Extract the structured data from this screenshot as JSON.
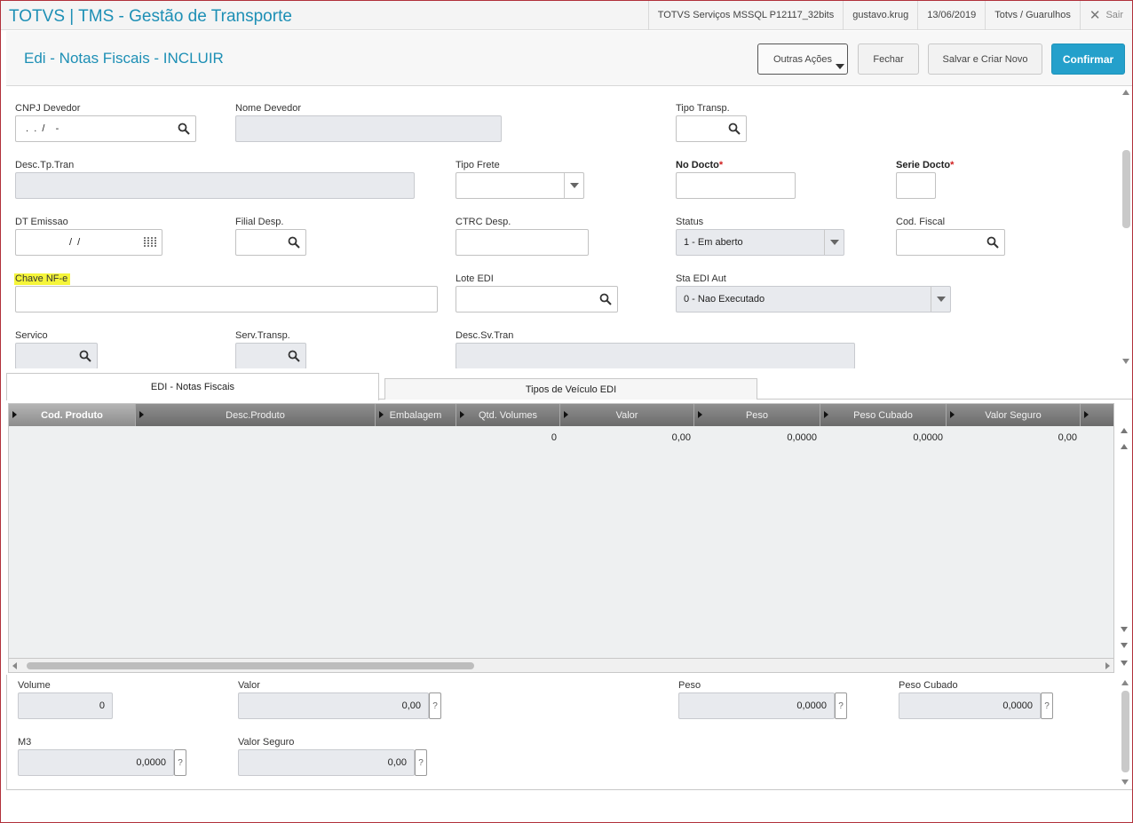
{
  "app": {
    "title": "TOTVS | TMS - Gestão de Transporte",
    "environment": "TOTVS Serviços MSSQL P12117_32bits",
    "user": "gustavo.krug",
    "date": "13/06/2019",
    "branch": "Totvs / Guarulhos",
    "exit_label": "Sair"
  },
  "header": {
    "page_title": "Edi - Notas Fiscais - INCLUIR",
    "btn_outras": "Outras Ações",
    "btn_fechar": "Fechar",
    "btn_salvar": "Salvar e Criar Novo",
    "btn_confirmar": "Confirmar"
  },
  "form": {
    "cnpj_devedor": {
      "label": "CNPJ Devedor",
      "value": " .  .  /    -"
    },
    "nome_devedor": {
      "label": "Nome Devedor",
      "value": ""
    },
    "tipo_transp": {
      "label": "Tipo Transp.",
      "value": ""
    },
    "desc_tp_tran": {
      "label": "Desc.Tp.Tran",
      "value": ""
    },
    "tipo_frete": {
      "label": "Tipo Frete",
      "value": ""
    },
    "no_docto": {
      "label": "No Docto",
      "required": "*",
      "value": ""
    },
    "serie_docto": {
      "label": "Serie Docto",
      "required": "*",
      "value": ""
    },
    "dt_emissao": {
      "label": "DT Emissao",
      "value": "/  /"
    },
    "filial_desp": {
      "label": "Filial Desp.",
      "value": ""
    },
    "ctrc_desp": {
      "label": "CTRC Desp.",
      "value": ""
    },
    "status": {
      "label": "Status",
      "value": "1 - Em aberto"
    },
    "cod_fiscal": {
      "label": "Cod. Fiscal",
      "value": ""
    },
    "chave_nfe": {
      "label": "Chave NF-e",
      "value": ""
    },
    "lote_edi": {
      "label": "Lote EDI",
      "value": ""
    },
    "sta_edi_aut": {
      "label": "Sta EDI Aut",
      "value": "0 - Nao Executado"
    },
    "servico": {
      "label": "Servico",
      "value": ""
    },
    "serv_transp": {
      "label": "Serv.Transp.",
      "value": ""
    },
    "desc_sv_tran": {
      "label": "Desc.Sv.Tran",
      "value": ""
    }
  },
  "tabs": [
    {
      "label": "EDI - Notas Fiscais",
      "active": true
    },
    {
      "label": "Tipos de Veículo EDI",
      "active": false
    }
  ],
  "grid": {
    "columns": [
      "Cod. Produto",
      "Desc.Produto",
      "Embalagem",
      "Qtd. Volumes",
      "Valor",
      "Peso",
      "Peso Cubado",
      "Valor Seguro"
    ],
    "rows": [
      [
        "",
        "",
        "",
        "0",
        "0,00",
        "0,0000",
        "0,0000",
        "0,00"
      ]
    ]
  },
  "totals": {
    "volume": {
      "label": "Volume",
      "value": "0"
    },
    "valor": {
      "label": "Valor",
      "value": "0,00"
    },
    "peso": {
      "label": "Peso",
      "value": "0,0000"
    },
    "peso_cubado": {
      "label": "Peso Cubado",
      "value": "0,0000"
    },
    "m3": {
      "label": "M3",
      "value": "0,0000"
    },
    "valor_seguro": {
      "label": "Valor Seguro",
      "value": "0,00"
    },
    "help_glyph": "?"
  },
  "colors": {
    "brand": "#1d8fb5",
    "confirm": "#24a0cb",
    "highlight": "#f5f53a",
    "required": "#d02020"
  }
}
